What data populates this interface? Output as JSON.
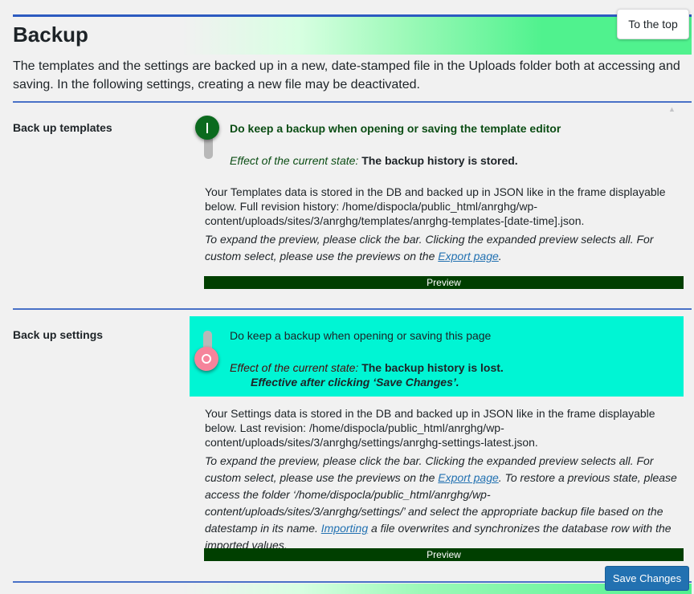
{
  "header": {
    "title": "Backup",
    "to_top_label": "To the top",
    "intro": "The templates and the settings are backed up in a new, date-stamped file in the Uploads folder both at accessing and saving. In the following settings, creating a new file may be deactivated."
  },
  "templates": {
    "label": "Back up templates",
    "toggle_state": "on",
    "option_label": "Do keep a backup when opening or saving the template editor",
    "effect_lead": "Effect of the current state: ",
    "effect_value": "The backup history is stored.",
    "description": "Your Templates data is stored in the DB and backed up in JSON like in the frame displayable below. Full revision history: /home/dispocla/public_html/anrghg/wp-content/uploads/sites/3/anrghg/templates/anrghg-templates-[date-time].json.",
    "hint_before": "To expand the preview, please click the bar. Clicking the expanded preview selects all. For custom select, please use the previews on the ",
    "hint_link": "Export page",
    "hint_after": ".",
    "preview_label": "Preview"
  },
  "settings": {
    "label": "Back up settings",
    "toggle_state": "off",
    "option_label": "Do keep a backup when opening or saving this page",
    "effect_lead": "Effect of the current state: ",
    "effect_value": "The backup history is lost.",
    "effect_note": "Effective after clicking ‘Save Changes’.",
    "description": "Your Settings data is stored in the DB and backed up in JSON like in the frame displayable below. Last revision: /home/dispocla/public_html/anrghg/wp-content/uploads/sites/3/anrghg/settings/anrghg-settings-latest.json.",
    "hint_before": "To expand the preview, please click the bar. Clicking the expanded preview selects all. For custom select, please use the previews on the ",
    "hint_link": "Export page",
    "hint_middle": ". To restore a previous state, please access the folder ‘/home/dispocla/public_html/anrghg/wp-content/uploads/sites/3/anrghg/settings/’ and select the appropriate backup file based on the datestamp in its name. ",
    "hint_link2": "Importing",
    "hint_after": " a file overwrites and synchronizes the database row with the imported values.",
    "preview_label": "Preview"
  },
  "footer": {
    "save_label": "Save Changes"
  },
  "colors": {
    "accent_rule": "#2c5ac0",
    "toggle_on": "#0b6a1e",
    "toggle_off": "#f5849b",
    "off_highlight": "#00f5d4",
    "preview_bar": "#003f00",
    "primary_button": "#2271b1"
  }
}
